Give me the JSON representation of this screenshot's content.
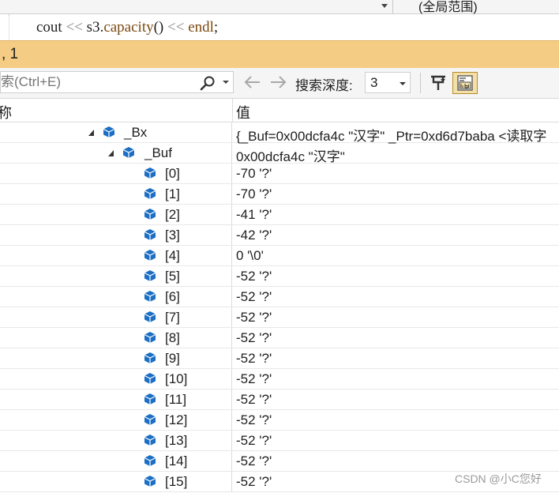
{
  "topbar": {
    "scope": "(全局范围)"
  },
  "code": {
    "tokens": [
      "cout ",
      "<< ",
      "s3",
      ".",
      "capacity",
      "() ",
      "<< ",
      "endl",
      ";"
    ]
  },
  "window": {
    "title": ", 1"
  },
  "toolbar": {
    "search_placeholder": "索(Ctrl+E)",
    "depth_label": "搜索深度:",
    "depth_value": "3"
  },
  "grid": {
    "col_name": "称",
    "col_value": "值",
    "rows": [
      {
        "name": "_Bx",
        "value": "{_Buf=0x00dcfa4c \"汉字\" _Ptr=0xd6d7baba <读取字"
      },
      {
        "name": "_Buf",
        "value": "0x00dcfa4c \"汉字\""
      },
      {
        "name": "[0]",
        "value": "-70 '?'"
      },
      {
        "name": "[1]",
        "value": "-70 '?'"
      },
      {
        "name": "[2]",
        "value": "-41 '?'"
      },
      {
        "name": "[3]",
        "value": "-42 '?'"
      },
      {
        "name": "[4]",
        "value": "0 '\\0'"
      },
      {
        "name": "[5]",
        "value": "-52 '?'"
      },
      {
        "name": "[6]",
        "value": "-52 '?'"
      },
      {
        "name": "[7]",
        "value": "-52 '?'"
      },
      {
        "name": "[8]",
        "value": "-52 '?'"
      },
      {
        "name": "[9]",
        "value": "-52 '?'"
      },
      {
        "name": "[10]",
        "value": "-52 '?'"
      },
      {
        "name": "[11]",
        "value": "-52 '?'"
      },
      {
        "name": "[12]",
        "value": "-52 '?'"
      },
      {
        "name": "[13]",
        "value": "-52 '?'"
      },
      {
        "name": "[14]",
        "value": "-52 '?'"
      },
      {
        "name": "[15]",
        "value": "-52 '?'"
      }
    ]
  },
  "watermark": "CSDN @小C您好",
  "colors": {
    "title_bar": "#f5cc84",
    "icon_blue": "#1c6fc4",
    "toggle_active": "#f3dfa8"
  },
  "icons": {
    "expand": "triangle-expanded-icon",
    "object": "object-cube-icon",
    "search": "search-icon"
  }
}
